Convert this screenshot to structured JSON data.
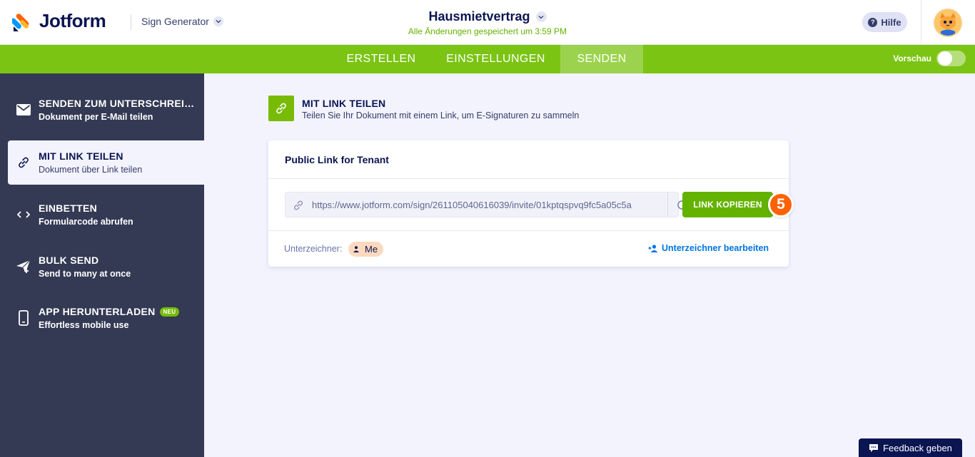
{
  "header": {
    "logo_text": "Jotform",
    "product_label": "Sign Generator",
    "doc_title": "Hausmietvertrag",
    "saved_status": "Alle Änderungen gespeichert um 3:59 PM",
    "help_label": "Hilfe"
  },
  "nav": {
    "tabs": [
      {
        "label": "ERSTELLEN"
      },
      {
        "label": "EINSTELLUNGEN"
      },
      {
        "label": "SENDEN"
      }
    ],
    "active_tab": "SENDEN",
    "preview_label": "Vorschau",
    "preview_on": false
  },
  "sidebar": {
    "items": [
      {
        "title": "SENDEN ZUM UNTERSCHREIBEN",
        "subtitle": "Dokument per E-Mail teilen",
        "icon": "envelope-icon"
      },
      {
        "title": "MIT LINK TEILEN",
        "subtitle": "Dokument über Link teilen",
        "icon": "link-icon"
      },
      {
        "title": "EINBETTEN",
        "subtitle": "Formularcode abrufen",
        "icon": "code-icon"
      },
      {
        "title": "BULK SEND",
        "subtitle": "Send to many at once",
        "icon": "paper-plane-icon"
      },
      {
        "title": "APP HERUNTERLADEN",
        "subtitle": "Effortless mobile use",
        "icon": "smartphone-icon",
        "badge": "NEU"
      }
    ],
    "active_index": 1
  },
  "main": {
    "section_title": "MIT LINK TEILEN",
    "section_desc": "Teilen Sie Ihr Dokument mit einem Link, um E-Signaturen zu sammeln",
    "card": {
      "title": "Public Link for Tenant",
      "link_url": "https://www.jotform.com/sign/261105040616039/invite/01kptqspvq9fc5a05c5a",
      "copy_button": "LINK KOPIEREN",
      "step_number": "5",
      "signers_label": "Unterzeichner:",
      "signer_name": "Me",
      "edit_signers": "Unterzeichner bearbeiten"
    }
  },
  "feedback_label": "Feedback geben",
  "colors": {
    "brand_green": "#7bc413",
    "button_green": "#64b200",
    "navy": "#0a1551",
    "sidebar_bg": "#343a54",
    "step_orange": "#ff6100",
    "link_blue": "#0075e3"
  }
}
